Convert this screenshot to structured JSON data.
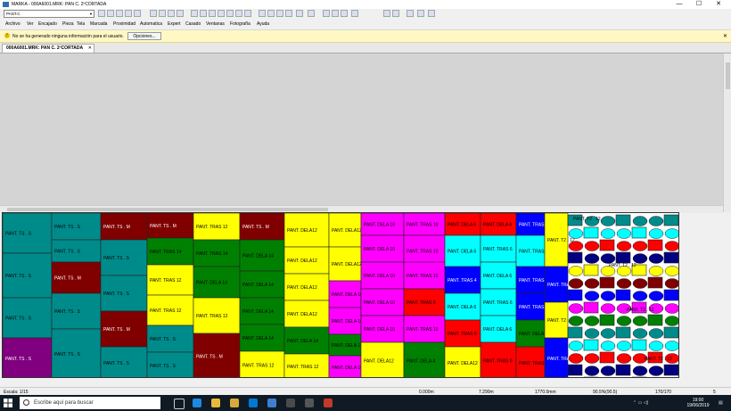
{
  "window": {
    "title": "MARKA - 000A6001.MRK: PAN C. 2ºCORTADA",
    "minimize": "—",
    "maximize": "☐",
    "close": "✕"
  },
  "toolbar": {
    "combo_value": "PANT.C"
  },
  "menu": [
    "Archivo",
    "Ver",
    "Encajado",
    "Pieza",
    "Tela",
    "Marcada",
    "Proximidad",
    "Automatica",
    "Expert",
    "Casado",
    "Ventanas",
    "Fotografía",
    "Ayuda"
  ],
  "infobar": {
    "icon": "!",
    "message": "No se ha generado ninguna información para el usuario.",
    "options_button": "Opciones...",
    "close": "✕"
  },
  "tab": {
    "label": "000A6001.MRK: PAN C. 2ºCORTADA",
    "close": "✕"
  },
  "status": {
    "scale": "Escala: 1/15",
    "pos1": "0.000m",
    "pos2": "7.290m",
    "width": "1770.0mm",
    "efficiency": "90.5%(90.5)",
    "pieces": "170/170",
    "extra": "5"
  },
  "taskbar": {
    "search_placeholder": "Escribe aquí para buscar",
    "time": "19:00",
    "date": "19/06/2019"
  },
  "colors": {
    "teal": "#008b8b",
    "maroon": "#800000",
    "green": "#008000",
    "yellow": "#ffff00",
    "magenta": "#ff00ff",
    "navy": "#000080",
    "red": "#ff0000",
    "cyan": "#00ffff",
    "blue": "#0000ff",
    "purple": "#800080",
    "infobar": "#fff8c4"
  },
  "marker": {
    "pieces": [
      {
        "label": "PANT. TS . S",
        "color": "teal"
      },
      {
        "label": "PANT. TS . S",
        "color": "teal"
      },
      {
        "label": "PANT. TS . M",
        "color": "maroon"
      },
      {
        "label": "PANT. TS . S",
        "color": "teal"
      },
      {
        "label": "PANT. TRAS 14",
        "color": "green"
      },
      {
        "label": "PANT. TRAS 12",
        "color": "yellow"
      },
      {
        "label": "PANT. DELA 14",
        "color": "green"
      },
      {
        "label": "PANT. DELA12",
        "color": "yellow"
      },
      {
        "label": "PANT. DELA 10",
        "color": "magenta"
      },
      {
        "label": "PANT. TRAS 10",
        "color": "magenta"
      },
      {
        "label": "PANT. DELA 6",
        "color": "red"
      },
      {
        "label": "PANT. DELA 6",
        "color": "cyan"
      },
      {
        "label": "PANT. TRAS 6",
        "color": "cyan"
      },
      {
        "label": "PANT. TRAS 4",
        "color": "blue"
      },
      {
        "label": "PANT. T2 . 12",
        "color": "yellow"
      },
      {
        "label": "PANT. TRAS 8",
        "color": "red"
      },
      {
        "label": "PANT. TS . S",
        "color": "teal"
      },
      {
        "label": "PANT. TS . M",
        "color": "maroon"
      },
      {
        "label": "PANT. TS . S",
        "color": "purple"
      },
      {
        "label": "PANT. DELA 4",
        "color": "green"
      },
      {
        "label": "PANT. TRAS 5",
        "color": "cyan"
      },
      {
        "label": "PANT. DELA 8",
        "color": "magenta"
      }
    ]
  }
}
